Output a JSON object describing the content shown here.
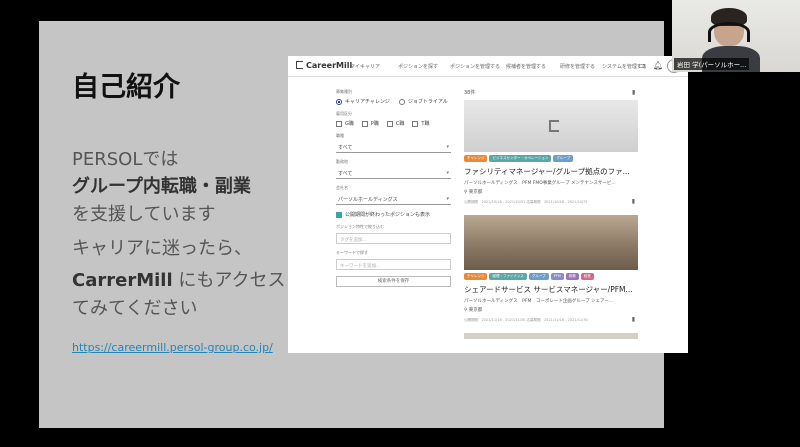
{
  "slide": {
    "title": "自己紹介",
    "line1": "PERSOLでは",
    "line2": "グループ内転職・副業",
    "line3": "を支援しています",
    "line4": "キャリアに迷ったら、",
    "line5_bold": "CarrerMill",
    "line5_rest": " にもアクセスし",
    "line6": "てみてください",
    "link": "https://careermill.persol-group.co.jp/"
  },
  "app": {
    "logo": "CareerMill",
    "nav": [
      "マイキャリア",
      "ポジションを探す",
      "ポジションを管理する",
      "候補者を管理する",
      "研修を管理する",
      "システムを管理する"
    ],
    "filters": {
      "type_label": "募集種別",
      "radio_options": [
        "キャリアチャレンジ",
        "ジョブトライアル"
      ],
      "selected_radio": "キャリアチャレンジ",
      "level_label": "雇用区分",
      "checkbox_options": [
        "G職",
        "P職",
        "C職",
        "T職"
      ],
      "category_label": "職種",
      "category_value": "すべて",
      "area_label": "勤務地",
      "area_value": "すべて",
      "company_label": "会社名",
      "company_value": "パーソルホールディングス",
      "closed_label": "公開期間が終わったポジションも表示",
      "closed_checked": true,
      "tag_label": "ポジション特性で絞り込む",
      "tag_placeholder": "タグを追加...",
      "keyword_label": "キーワードで探す",
      "keyword_placeholder": "キーワードを追加...",
      "save_label": "検索条件を保存"
    },
    "results_count": "38件",
    "cards": [
      {
        "tags": [
          "チャレンジ",
          "ビジネスセンター・オペレーション",
          "グループ"
        ],
        "title": "ファシリティマネージャー/グループ拠点のファ...",
        "sub": "パーソルホールディングス　PFM FMO事業グループ メンテナンスサービ...",
        "location": "東京都",
        "meta": "公開期間　2021/10/18 - 2021/10/31 応募期間　2021/10/18 - 2021/10/31"
      },
      {
        "tags": [
          "チャレンジ",
          "経理・ファイナンス",
          "グループ",
          "PFM",
          "総務",
          "経営"
        ],
        "title": "シェアードサービス サービスマネージャー/PFM...",
        "sub": "パーソルホールディングス　PFM　コーポレート企画グループ シェアー...",
        "location": "東京都",
        "meta": "公開期間　2021/11/16 - 2021/11/30 応募期間　2021/11/16 - 2021/11/30"
      }
    ]
  },
  "tag_colors": [
    "#e88a3a",
    "#5aa6a8",
    "#6b9fc9",
    "#8a8ad0",
    "#9a76b6",
    "#d06a8a"
  ],
  "camera": {
    "name": "岩田 学(パーソルホー..."
  }
}
